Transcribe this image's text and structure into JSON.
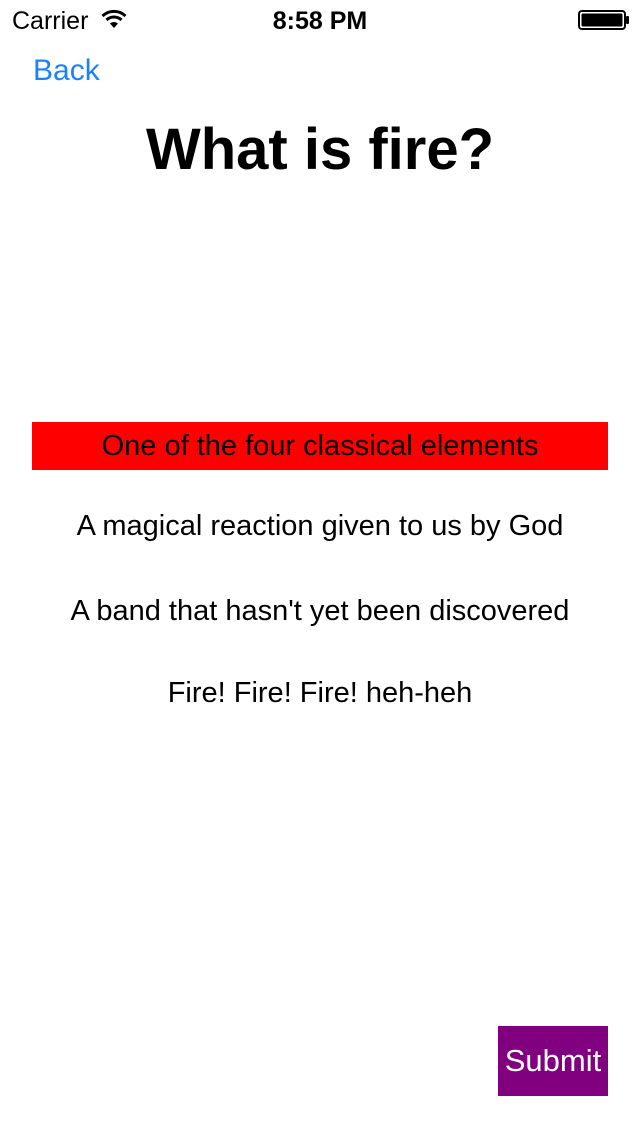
{
  "status_bar": {
    "carrier": "Carrier",
    "time": "8:58 PM",
    "wifi_icon": "wifi-icon",
    "battery_icon": "battery-full-icon"
  },
  "nav": {
    "back_label": "Back"
  },
  "question": {
    "title": "What is fire?"
  },
  "answers": [
    {
      "label": "One of the four classical elements",
      "selected": true
    },
    {
      "label": "A magical reaction given to us by God",
      "selected": false
    },
    {
      "label": "A band that hasn't yet been discovered",
      "selected": false
    },
    {
      "label": "Fire! Fire! Fire! heh-heh",
      "selected": false
    }
  ],
  "submit": {
    "label": "Submit"
  },
  "colors": {
    "link_blue": "#1a82fb",
    "selected_answer_bg": "#ff0000",
    "submit_bg": "#800080"
  }
}
